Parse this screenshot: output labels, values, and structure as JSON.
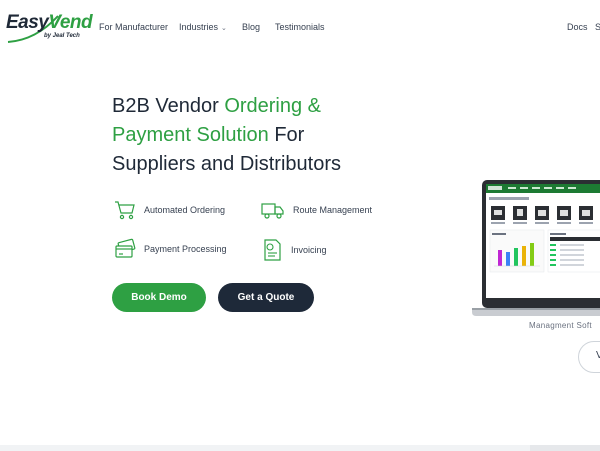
{
  "brand": {
    "name_part1": "Easy",
    "name_part2": "Vend",
    "byline": "by Jeal Tech",
    "color_green": "#2ea043",
    "color_dark": "#1e2939"
  },
  "nav": {
    "links": [
      {
        "label": "For Manufacturer"
      },
      {
        "label": "Industries"
      },
      {
        "label": "Blog"
      },
      {
        "label": "Testimonials"
      }
    ],
    "right_links": [
      {
        "label": "Docs"
      },
      {
        "label": "S"
      }
    ]
  },
  "hero": {
    "line1_a": "B2B Vendor ",
    "line1_b": "Ordering &",
    "line2_a": "Payment Solution",
    "line2_b": " For",
    "line3": "Suppliers and Distributors",
    "features": [
      {
        "label": "Automated Ordering",
        "icon": "shopping-cart-icon"
      },
      {
        "label": "Route Management",
        "icon": "delivery-truck-icon"
      },
      {
        "label": "Payment Processing",
        "icon": "credit-card-icon"
      },
      {
        "label": "Invoicing",
        "icon": "invoice-icon"
      }
    ],
    "cta_primary": "Book Demo",
    "cta_secondary": "Get a Quote"
  },
  "showcase": {
    "caption": "Managment Soft",
    "pill_icon": "chevron-right-icon",
    "pill_text": "V"
  }
}
